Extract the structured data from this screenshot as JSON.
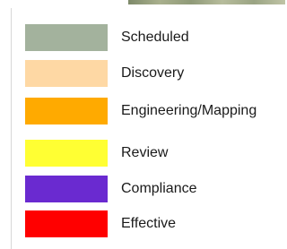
{
  "legend": {
    "items": [
      {
        "label": "Scheduled",
        "color": "#a3b29d"
      },
      {
        "label": "Discovery",
        "color": "#fed8a4"
      },
      {
        "label": "Engineering/Mapping",
        "color": "#ffaa00"
      },
      {
        "label": "Review",
        "color": "#ffff33"
      },
      {
        "label": "Compliance",
        "color": "#6a2ad0"
      },
      {
        "label": "Effective",
        "color": "#ff0000"
      }
    ]
  }
}
